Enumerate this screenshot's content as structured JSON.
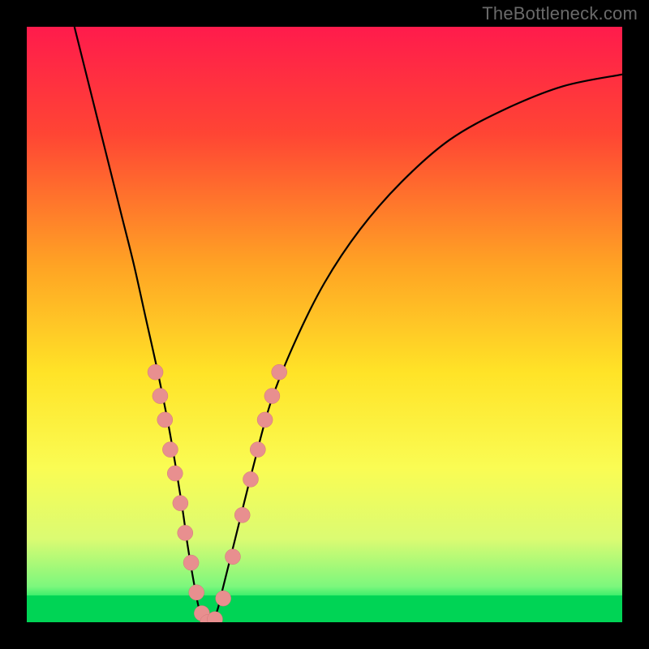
{
  "watermark": "TheBottleneck.com",
  "colors": {
    "frame_bg": "#000000",
    "watermark_color": "#6a6a6a",
    "curve_color": "#000000",
    "marker_fill": "#e88f8f",
    "marker_stroke": "#d17878",
    "green_band": "#00e55b",
    "green_bottom": "#00d455"
  },
  "chart_data": {
    "type": "line",
    "title": "",
    "xlabel": "",
    "ylabel": "",
    "xlim": [
      0,
      100
    ],
    "ylim": [
      0,
      100
    ],
    "grid": false,
    "legend": false,
    "background_gradient": {
      "stops": [
        {
          "pos": 0.0,
          "color": "#ff1b4c"
        },
        {
          "pos": 0.18,
          "color": "#ff4534"
        },
        {
          "pos": 0.4,
          "color": "#ffa324"
        },
        {
          "pos": 0.58,
          "color": "#ffe327"
        },
        {
          "pos": 0.74,
          "color": "#fafc53"
        },
        {
          "pos": 0.86,
          "color": "#dbfb72"
        },
        {
          "pos": 0.94,
          "color": "#7cf77d"
        },
        {
          "pos": 0.97,
          "color": "#00e55b"
        },
        {
          "pos": 1.0,
          "color": "#00d455"
        }
      ]
    },
    "series": [
      {
        "name": "bottleneck-curve",
        "x": [
          8,
          10,
          12,
          14,
          16,
          18,
          20,
          22,
          24,
          26,
          27,
          28,
          29,
          30,
          31,
          32,
          33,
          35,
          38,
          41,
          45,
          50,
          56,
          63,
          71,
          80,
          90,
          100
        ],
        "y": [
          100,
          92,
          84,
          76,
          68,
          60,
          51,
          42,
          32,
          20,
          13,
          7,
          2,
          0,
          0,
          2,
          6,
          14,
          26,
          37,
          47,
          57,
          66,
          74,
          81,
          86,
          90,
          92
        ]
      }
    ],
    "markers": {
      "name": "highlight-points",
      "points": [
        {
          "x": 21.6,
          "y": 42
        },
        {
          "x": 22.4,
          "y": 38
        },
        {
          "x": 23.2,
          "y": 34
        },
        {
          "x": 24.1,
          "y": 29
        },
        {
          "x": 24.9,
          "y": 25
        },
        {
          "x": 25.8,
          "y": 20
        },
        {
          "x": 26.6,
          "y": 15
        },
        {
          "x": 27.6,
          "y": 10
        },
        {
          "x": 28.5,
          "y": 5
        },
        {
          "x": 29.4,
          "y": 1.5
        },
        {
          "x": 30.4,
          "y": 0
        },
        {
          "x": 31.6,
          "y": 0.5
        },
        {
          "x": 33.0,
          "y": 4
        },
        {
          "x": 34.6,
          "y": 11
        },
        {
          "x": 36.2,
          "y": 18
        },
        {
          "x": 37.6,
          "y": 24
        },
        {
          "x": 38.8,
          "y": 29
        },
        {
          "x": 40.0,
          "y": 34
        },
        {
          "x": 41.2,
          "y": 38
        },
        {
          "x": 42.4,
          "y": 42
        }
      ]
    }
  }
}
